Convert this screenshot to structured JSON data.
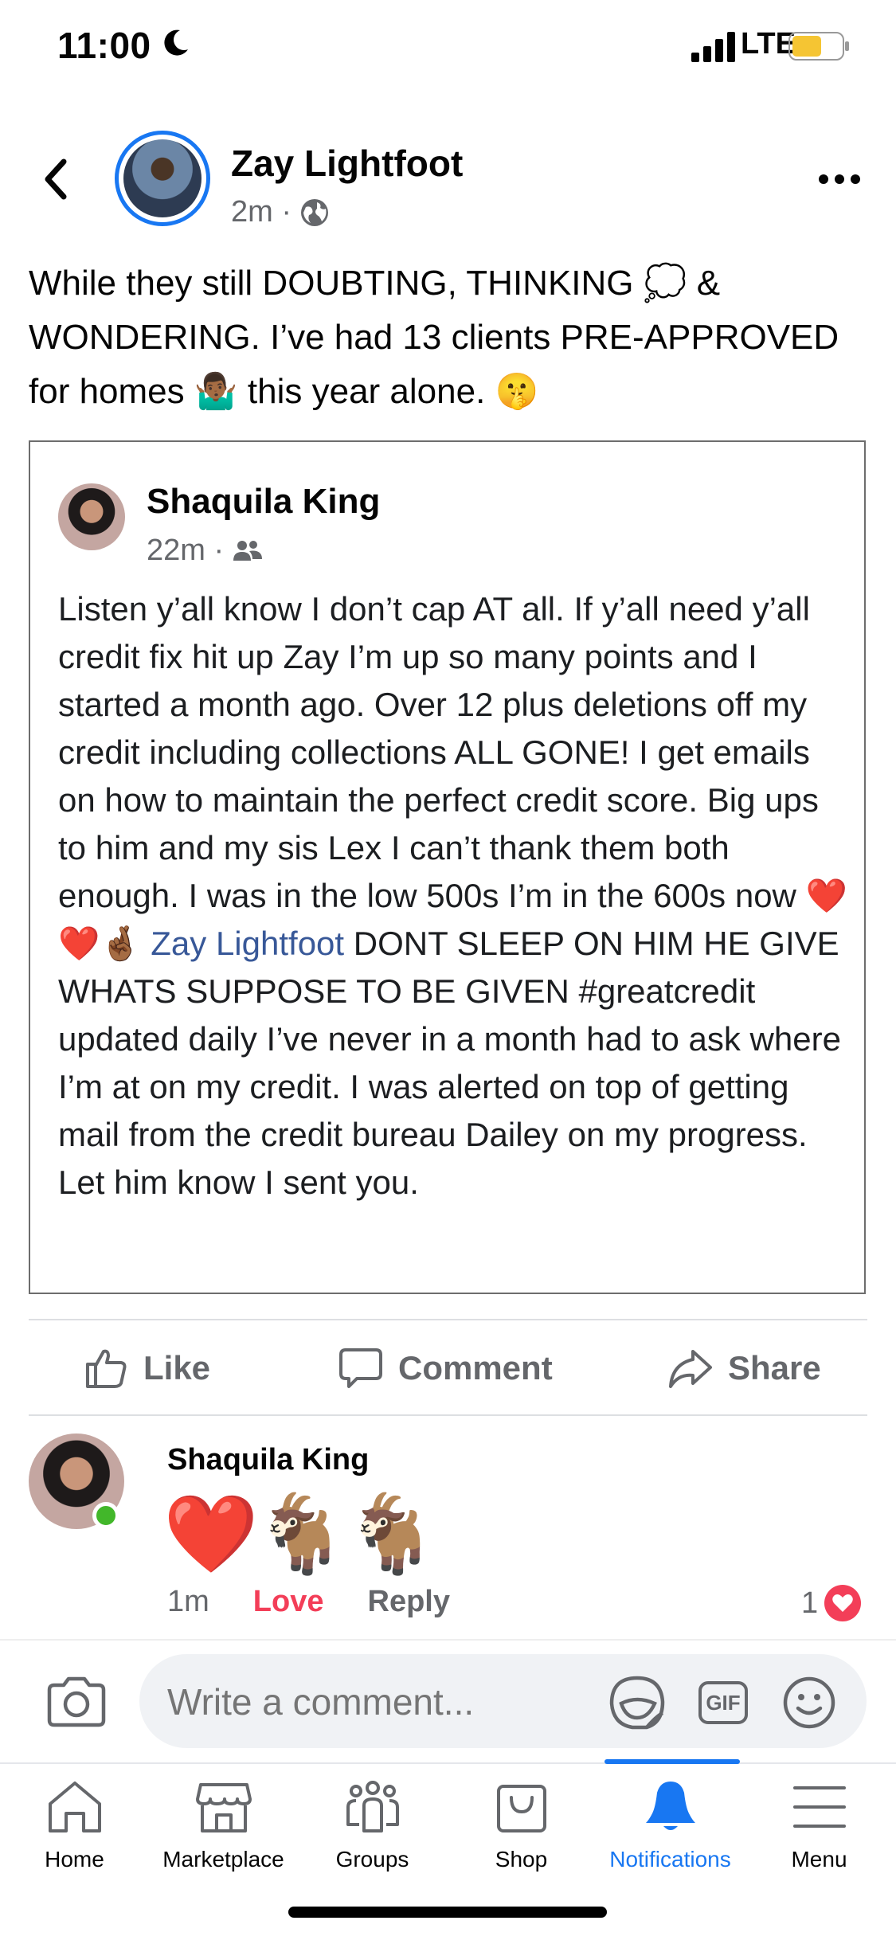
{
  "status_bar": {
    "time": "11:00",
    "network": "LTE"
  },
  "post": {
    "author": "Zay Lightfoot",
    "time": "2m ·",
    "text_parts": [
      "While they still DOUBTING, THINKING ",
      "💭",
      " & WONDERING. I’ve had 13 clients PRE-APPROVED for homes ",
      "🤷🏾‍♂️",
      " this year alone. ",
      "🤫"
    ]
  },
  "shared_post": {
    "author": "Shaquila King",
    "time": "22m ·",
    "text_before_emoji": "Listen y’all know I don’t cap AT all. If y’all need y’all credit fix hit up Zay I’m up so many points and I started a month ago. Over 12 plus deletions off my credit including collections ALL GONE! I get emails on how to maintain the perfect credit score. Big ups to him and my sis Lex I can’t thank them both enough. I was in the low 500s I’m in the 600s now ",
    "emojis": "❤️❤️🤞🏾",
    "mention": "Zay Lightfoot",
    "text_after_mention": " DONT SLEEP ON HIM HE GIVE WHATS SUPPOSE TO BE GIVEN #greatcredit updated daily I’ve never in a month had to ask where I’m at on my credit. I was alerted on top of getting mail from the credit bureau Dailey on my progress. Let him know I sent you."
  },
  "actions": {
    "like": "Like",
    "comment": "Comment",
    "share": "Share"
  },
  "comment": {
    "author": "Shaquila King",
    "body": "❤️🐐🐐",
    "time": "1m",
    "reaction_label": "Love",
    "reply_label": "Reply",
    "reaction_count": "1"
  },
  "composer": {
    "placeholder": "Write a comment...",
    "gif": "GIF"
  },
  "tabs": [
    {
      "label": "Home"
    },
    {
      "label": "Marketplace"
    },
    {
      "label": "Groups"
    },
    {
      "label": "Shop"
    },
    {
      "label": "Notifications",
      "active": true
    },
    {
      "label": "Menu"
    }
  ],
  "colors": {
    "accent": "#1877f2",
    "love": "#f33e58",
    "online": "#42b72a"
  }
}
